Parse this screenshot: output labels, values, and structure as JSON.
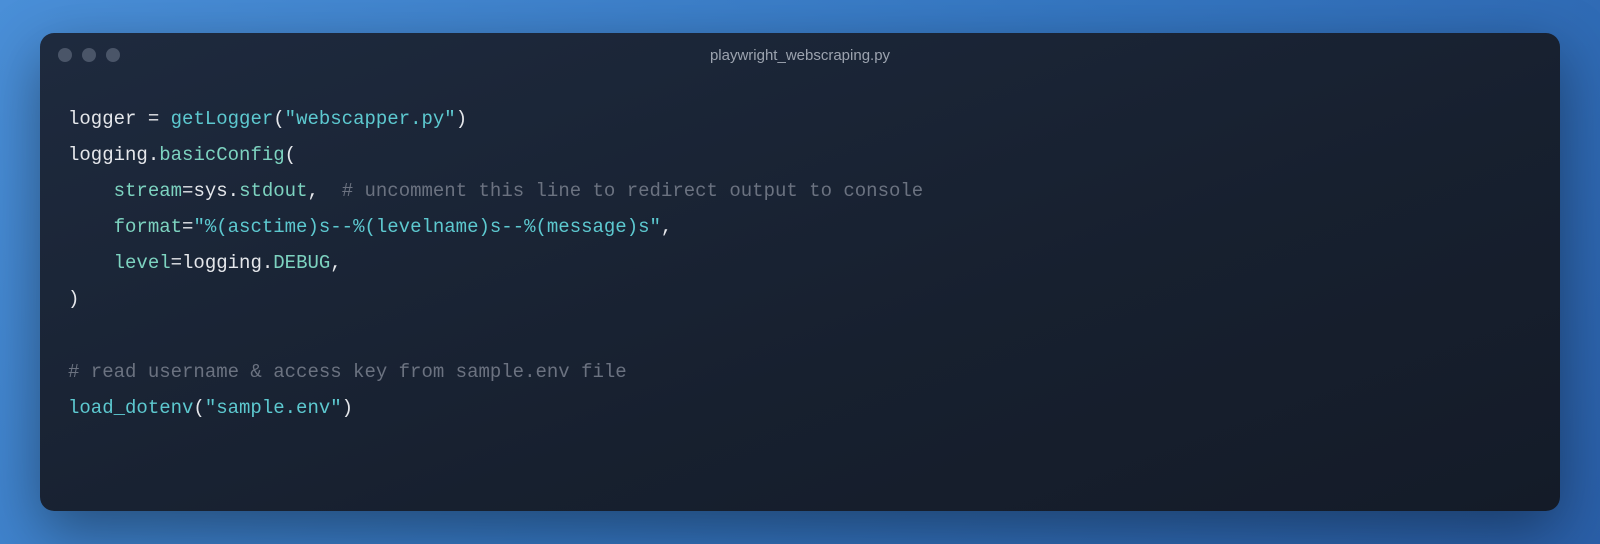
{
  "window": {
    "title": "playwright_webscraping.py"
  },
  "code": {
    "lines": [
      [
        {
          "cls": "tok-id",
          "text": "logger "
        },
        {
          "cls": "tok-op",
          "text": "="
        },
        {
          "cls": "tok-id",
          "text": " "
        },
        {
          "cls": "tok-fn",
          "text": "getLogger"
        },
        {
          "cls": "tok-punc",
          "text": "("
        },
        {
          "cls": "tok-str",
          "text": "\"webscapper.py\""
        },
        {
          "cls": "tok-punc",
          "text": ")"
        }
      ],
      [
        {
          "cls": "tok-module",
          "text": "logging"
        },
        {
          "cls": "tok-punc",
          "text": "."
        },
        {
          "cls": "tok-member",
          "text": "basicConfig"
        },
        {
          "cls": "tok-punc",
          "text": "("
        }
      ],
      [
        {
          "cls": "tok-id",
          "text": "    "
        },
        {
          "cls": "tok-attr",
          "text": "stream"
        },
        {
          "cls": "tok-op",
          "text": "="
        },
        {
          "cls": "tok-module",
          "text": "sys"
        },
        {
          "cls": "tok-punc",
          "text": "."
        },
        {
          "cls": "tok-member",
          "text": "stdout"
        },
        {
          "cls": "tok-punc",
          "text": ","
        },
        {
          "cls": "tok-comment",
          "text": "  # uncomment this line to redirect output to console"
        }
      ],
      [
        {
          "cls": "tok-id",
          "text": "    "
        },
        {
          "cls": "tok-attr",
          "text": "format"
        },
        {
          "cls": "tok-op",
          "text": "="
        },
        {
          "cls": "tok-str",
          "text": "\"%(asctime)s--%(levelname)s--%(message)s\""
        },
        {
          "cls": "tok-punc",
          "text": ","
        }
      ],
      [
        {
          "cls": "tok-id",
          "text": "    "
        },
        {
          "cls": "tok-attr",
          "text": "level"
        },
        {
          "cls": "tok-op",
          "text": "="
        },
        {
          "cls": "tok-module",
          "text": "logging"
        },
        {
          "cls": "tok-punc",
          "text": "."
        },
        {
          "cls": "tok-const",
          "text": "DEBUG"
        },
        {
          "cls": "tok-punc",
          "text": ","
        }
      ],
      [
        {
          "cls": "tok-punc",
          "text": ")"
        }
      ],
      [],
      [
        {
          "cls": "tok-comment",
          "text": "# read username & access key from sample.env file"
        }
      ],
      [
        {
          "cls": "tok-fn",
          "text": "load_dotenv"
        },
        {
          "cls": "tok-punc",
          "text": "("
        },
        {
          "cls": "tok-str",
          "text": "\"sample.env\""
        },
        {
          "cls": "tok-punc",
          "text": ")"
        }
      ]
    ]
  }
}
